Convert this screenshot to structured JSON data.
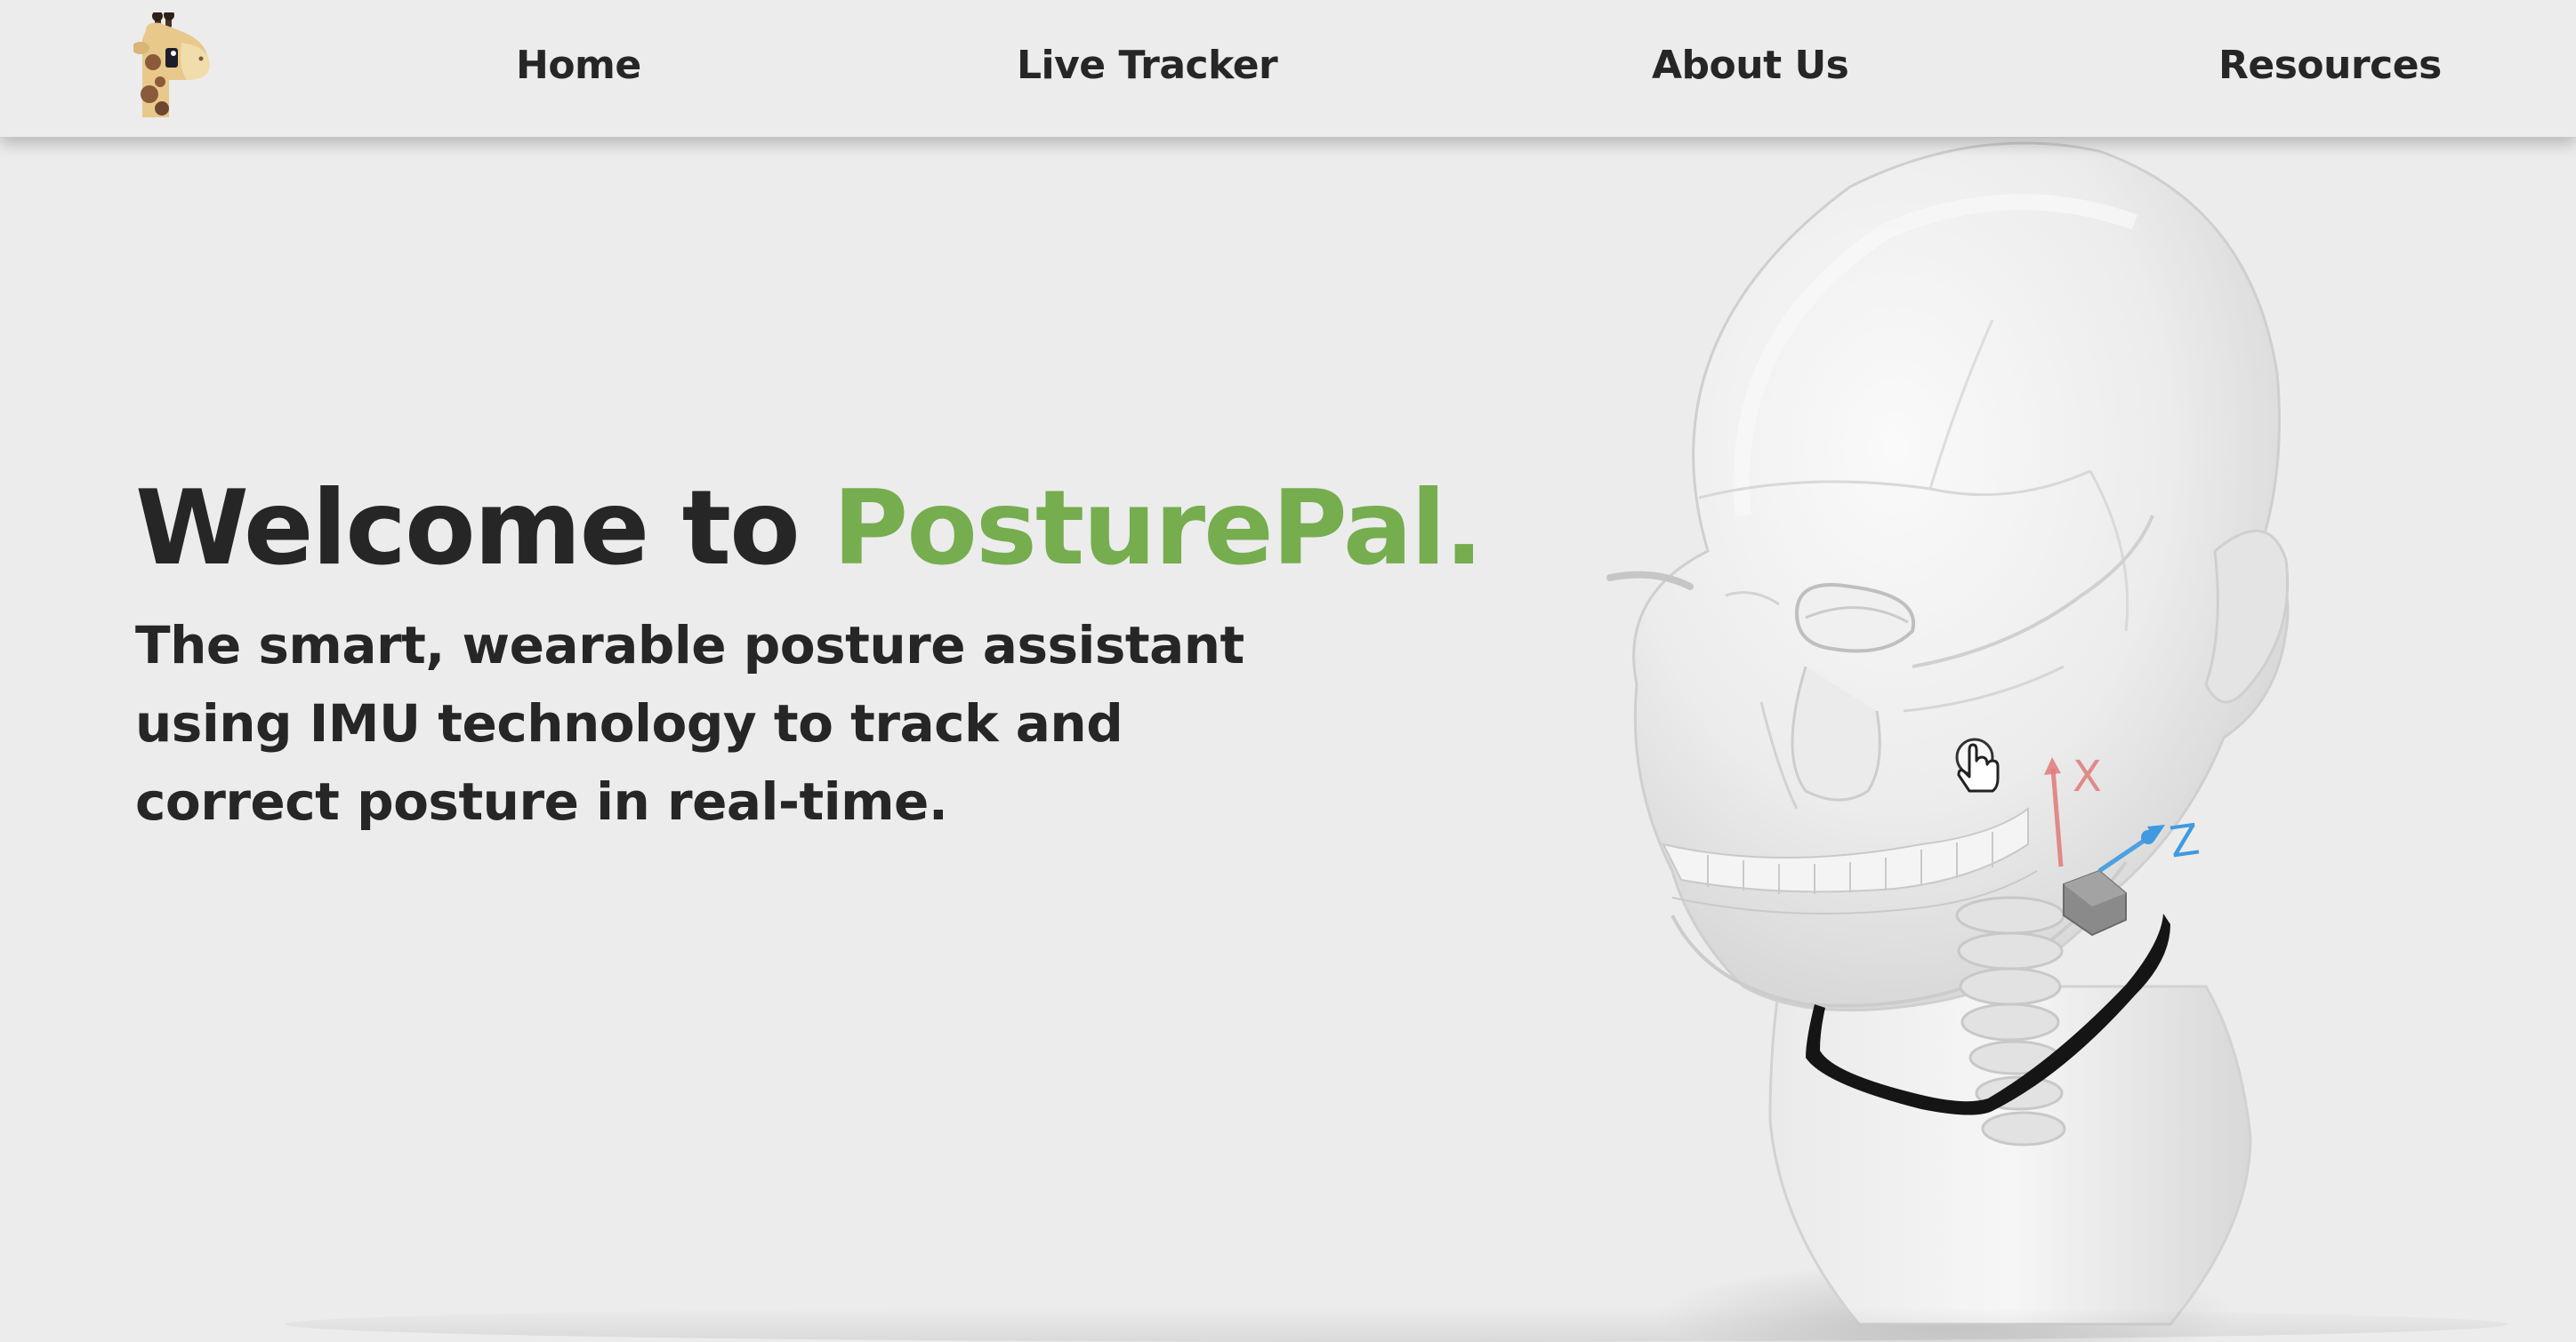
{
  "nav": {
    "logo_icon": "giraffe-logo-icon",
    "links": [
      {
        "label": "Home"
      },
      {
        "label": "Live Tracker"
      },
      {
        "label": "About Us"
      },
      {
        "label": "Resources"
      }
    ]
  },
  "hero": {
    "title_prefix": "Welcome to ",
    "title_brand": "PosturePal.",
    "subtitle": "The smart, wearable posture assistant using IMU technology to track and correct posture in real-time."
  },
  "model": {
    "axis_x_label": "X",
    "axis_z_label": "Z",
    "cursor_icon": "hand-pointer-icon",
    "colors": {
      "axis_x": "#e07a7a",
      "axis_z": "#3f9ae0",
      "collar": "#151515"
    }
  },
  "colors": {
    "background": "#ececec",
    "text": "#262626",
    "brand": "#76ad4f"
  }
}
